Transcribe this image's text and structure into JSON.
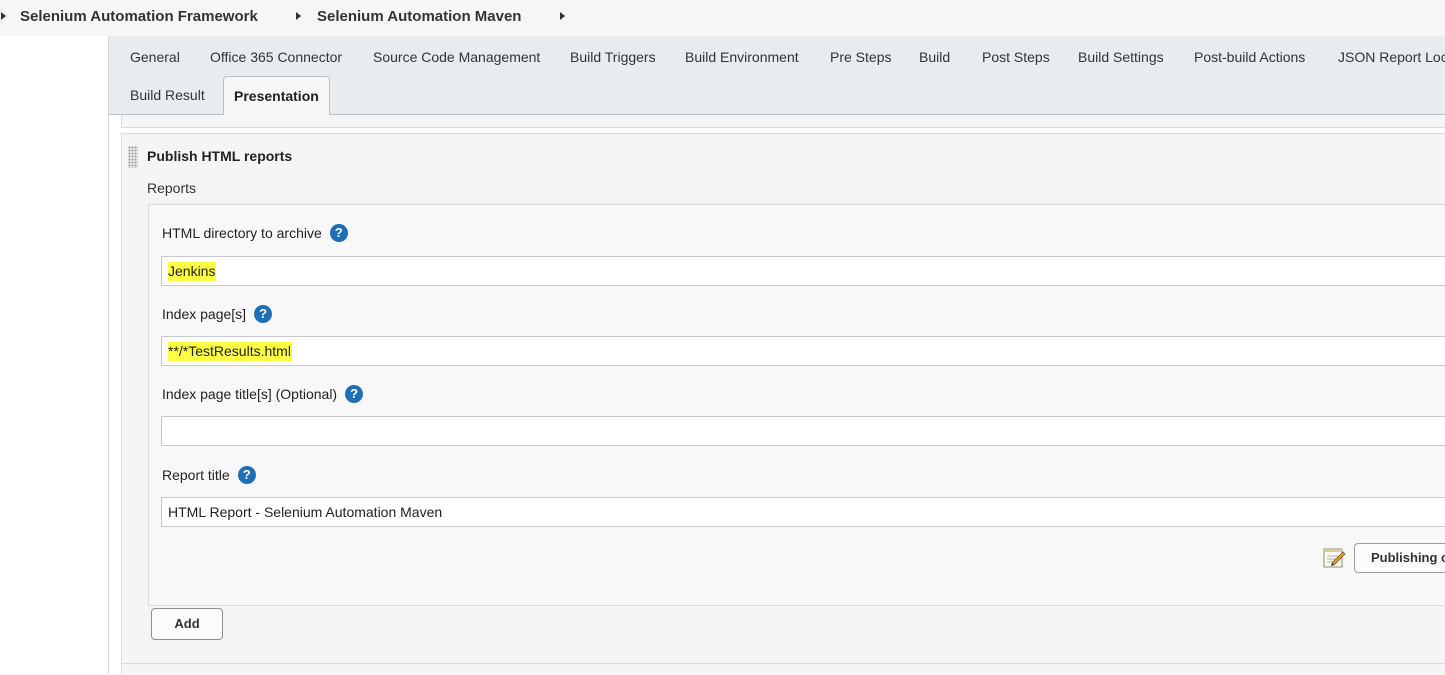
{
  "breadcrumb": {
    "items": [
      "Selenium Automation Framework",
      "Selenium Automation Maven"
    ]
  },
  "tabs": [
    {
      "label": "General"
    },
    {
      "label": "Office 365 Connector"
    },
    {
      "label": "Source Code Management"
    },
    {
      "label": "Build Triggers"
    },
    {
      "label": "Build Environment"
    },
    {
      "label": "Pre Steps"
    },
    {
      "label": "Build"
    },
    {
      "label": "Post Steps"
    },
    {
      "label": "Build Settings"
    },
    {
      "label": "Post-build Actions"
    },
    {
      "label": "JSON Report Loca"
    },
    {
      "label": "Build Result"
    },
    {
      "label": "Presentation",
      "active": true
    }
  ],
  "section": {
    "title": "Publish HTML reports",
    "reports_label": "Reports"
  },
  "fields": {
    "html_dir": {
      "label": "HTML directory to archive",
      "value": "Jenkins",
      "highlighted": true
    },
    "index_pages": {
      "label": "Index page[s]",
      "value": "**/*TestResults.html",
      "highlighted": true
    },
    "index_titles": {
      "label": "Index page title[s] (Optional)",
      "value": ""
    },
    "report_title": {
      "label": "Report title",
      "value": "HTML Report - Selenium Automation Maven"
    }
  },
  "help_glyph": "?",
  "buttons": {
    "publishing_options": "Publishing op",
    "add": "Add"
  },
  "colors": {
    "highlight": "#ffff44",
    "help_icon": "#1e6fb5",
    "tabbar_bg": "#e8ecef"
  },
  "icons": {
    "breadcrumb_separator": "caret-right-icon",
    "help": "question-mark-icon",
    "publishing": "notepad-pencil-icon",
    "drag": "drag-handle-icon"
  }
}
